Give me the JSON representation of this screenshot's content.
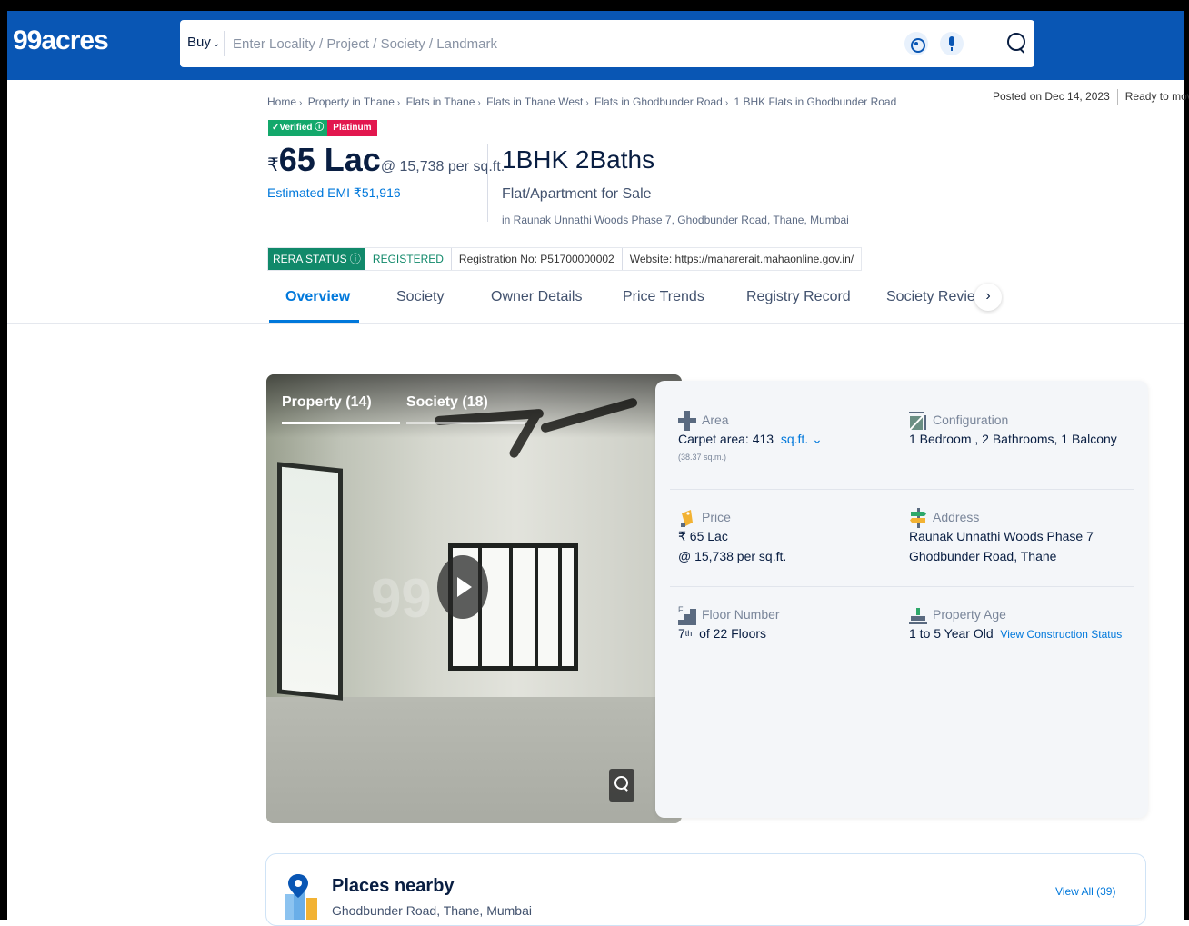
{
  "header": {
    "logo": "99acres",
    "buy_label": "Buy",
    "search_placeholder": "Enter Locality / Project / Society / Landmark"
  },
  "breadcrumb": [
    "Home",
    "Property in Thane",
    "Flats in Thane",
    "Flats in Thane West",
    "Flats in Ghodbunder Road",
    "1 BHK Flats in Ghodbunder Road"
  ],
  "posted": {
    "date": "Posted on Dec 14, 2023",
    "status": "Ready to move"
  },
  "badges": {
    "verified": "✓Verified ⓘ",
    "platinum": "Platinum"
  },
  "listing": {
    "currency": "₹",
    "price": "65 Lac",
    "per_sqft": "@ 15,738 per sq.ft.",
    "emi": "Estimated EMI ₹51,916",
    "bhk": "1BHK 2Baths",
    "type": "Flat/Apartment for Sale",
    "location": "in Raunak Unnathi Woods Phase 7, Ghodbunder Road, Thane, Mumbai"
  },
  "rera": {
    "status_label": "RERA STATUS ⓘ",
    "status": "REGISTERED",
    "reg_no": "Registration No: P51700000002",
    "website": "Website: https://maharerait.mahaonline.gov.in/"
  },
  "tabs": [
    "Overview",
    "Society",
    "Owner Details",
    "Price Trends",
    "Registry Record",
    "Society Reviews"
  ],
  "tab_next": "›",
  "gallery": {
    "tab_property": "Property (14)",
    "tab_society": "Society (18)",
    "watermark": "99"
  },
  "details": {
    "area": {
      "label": "Area",
      "value": "Carpet area: 413",
      "unit": "sq.ft.",
      "sub": "(38.37 sq.m.)"
    },
    "configuration": {
      "label": "Configuration",
      "value": "1 Bedroom , 2 Bathrooms, 1 Balcony"
    },
    "price": {
      "label": "Price",
      "value1": "₹ 65 Lac",
      "value2": "@ 15,738 per sq.ft."
    },
    "address": {
      "label": "Address",
      "value1": "Raunak Unnathi Woods Phase 7",
      "value2": "Ghodbunder Road, Thane"
    },
    "floor": {
      "label": "Floor Number",
      "num": "7",
      "sup": "th",
      "of": "of 22 Floors"
    },
    "age": {
      "label": "Property Age",
      "value": "1 to 5 Year Old",
      "link": "View Construction Status"
    }
  },
  "places": {
    "title": "Places nearby",
    "subtitle": "Ghodbunder Road, Thane, Mumbai",
    "view_all": "View All (39)"
  },
  "colors": {
    "brand": "#0956b4",
    "accent": "#0078db",
    "rera_green": "#11896a",
    "platinum": "#e2174e"
  }
}
